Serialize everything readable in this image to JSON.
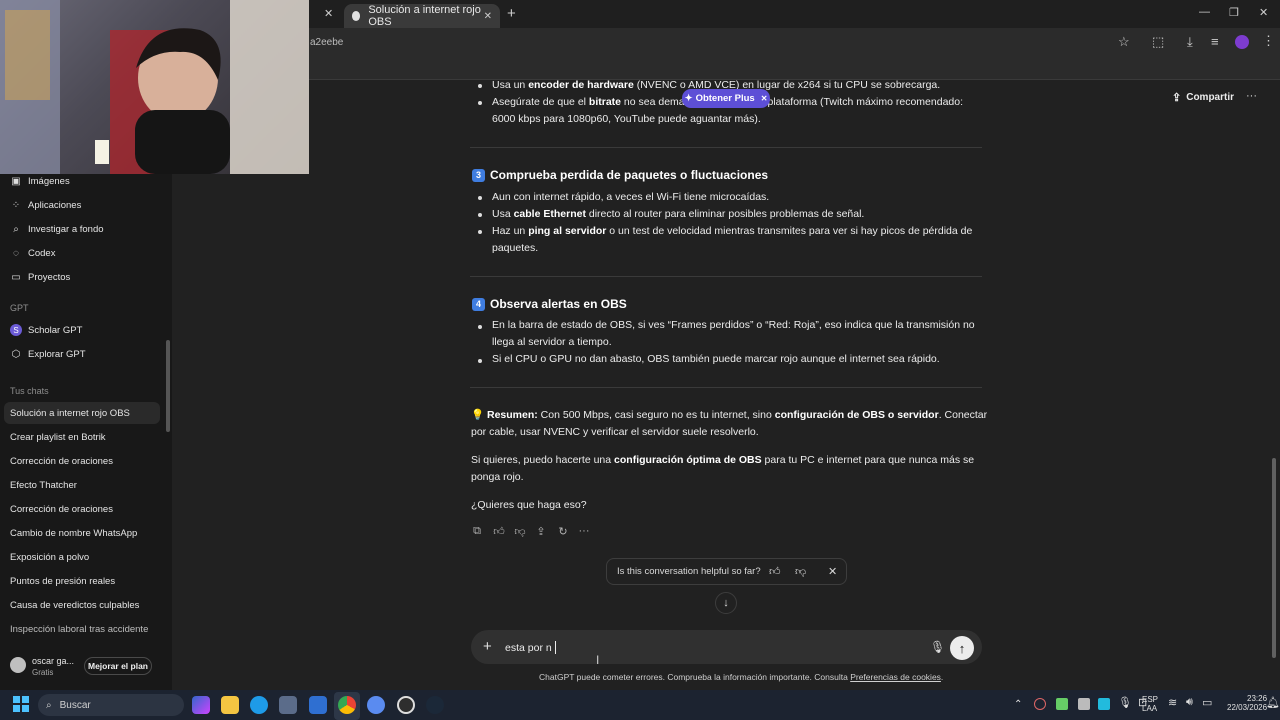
{
  "browser": {
    "active_tab_title": "Solución a internet rojo OBS",
    "url_fragment": "a2eebe",
    "new_tab_label": "+",
    "minimize": "—",
    "restore": "❐",
    "close": "✕"
  },
  "header": {
    "share_label": "Compartir",
    "more_label": "···",
    "plus_popup": "Obtener Plus"
  },
  "sidebar": {
    "items": [
      {
        "label": "Imágenes",
        "icon": "images-icon"
      },
      {
        "label": "Aplicaciones",
        "icon": "apps-icon"
      },
      {
        "label": "Investigar a fondo",
        "icon": "research-icon"
      },
      {
        "label": "Codex",
        "icon": "codex-icon"
      },
      {
        "label": "Proyectos",
        "icon": "folder-icon"
      }
    ],
    "gpt_heading": "GPT",
    "gpts": [
      {
        "label": "Scholar GPT",
        "icon": "scholar-icon"
      },
      {
        "label": "Explorar GPT",
        "icon": "explore-icon"
      }
    ],
    "chats_heading": "Tus chats",
    "chats": [
      "Solución a internet rojo OBS",
      "Crear playlist en Botrik",
      "Corrección de oraciones",
      "Efecto Thatcher",
      "Corrección de oraciones",
      "Cambio de nombre WhatsApp",
      "Exposición a polvo",
      "Puntos de presión reales",
      "Causa de veredictos culpables",
      "Inspección laboral tras accidente"
    ],
    "user_name": "oscar ga...",
    "user_plan": "Gratis",
    "upgrade_label": "Mejorar el plan"
  },
  "content": {
    "b1_pre": "Usa un ",
    "b1_bold": "encoder de hardware",
    "b1_post": " (NVENC o AMD VCE) en lugar de x264 si tu CPU se sobrecarga.",
    "b2_pre": "Asegúrate de que el ",
    "b2_bold": "bitrate",
    "b2_post": " no sea demasiado alto para la plataforma (Twitch máximo recomendado:",
    "b2_line2": "6000 kbps para 1080p60, YouTube puede aguantar más).",
    "h3_num": "3",
    "h3": "Comprueba perdida de paquetes o fluctuaciones",
    "s3_b1": "Aun con internet rápido, a veces el Wi-Fi tiene microcaídas.",
    "s3_b2_pre": "Usa ",
    "s3_b2_bold": "cable Ethernet",
    "s3_b2_post": " directo al router para eliminar posibles problemas de señal.",
    "s3_b3_pre": "Haz un ",
    "s3_b3_bold": "ping al servidor",
    "s3_b3_post": " o un test de velocidad mientras transmites para ver si hay picos de pérdida de",
    "s3_b3_line2": "paquetes.",
    "h4_num": "4",
    "h4": "Observa alertas en OBS",
    "s4_b1": "En la barra de estado de OBS, si ves “Frames perdidos” o “Red: Roja”, eso indica que la transmisión no",
    "s4_b1_line2": "llega al servidor a tiempo.",
    "s4_b2": "Si el CPU o GPU no dan abasto, OBS también puede marcar rojo aunque el internet sea rápido.",
    "summary_icon": "💡",
    "summary_label": "Resumen:",
    "summary_text": " Con 500 Mbps, casi seguro no es tu internet, sino ",
    "summary_bold": "configuración de OBS o servidor",
    "summary_end": ". Conectar",
    "summary_line2": "por cable, usar NVENC y verificar el servidor suele resolverlo.",
    "offer_pre": "Si quieres, puedo hacerte una ",
    "offer_bold": "configuración óptima de OBS",
    "offer_post": " para tu PC e internet para que nunca más se",
    "offer_line2": "ponga rojo.",
    "question": "¿Quieres que haga eso?"
  },
  "feedback": {
    "text": "Is this conversation helpful so far?"
  },
  "composer": {
    "plus": "+",
    "value": "esta por n",
    "send": "↑"
  },
  "disclaimer": {
    "text": "ChatGPT puede cometer errores. Comprueba la información importante. Consulta ",
    "link": "Preferencias de cookies",
    "end": "."
  },
  "taskbar": {
    "search_placeholder": "Buscar",
    "lang1": "ESP",
    "lang2": "LAA",
    "time": "23:26",
    "date": "22/03/2026"
  }
}
